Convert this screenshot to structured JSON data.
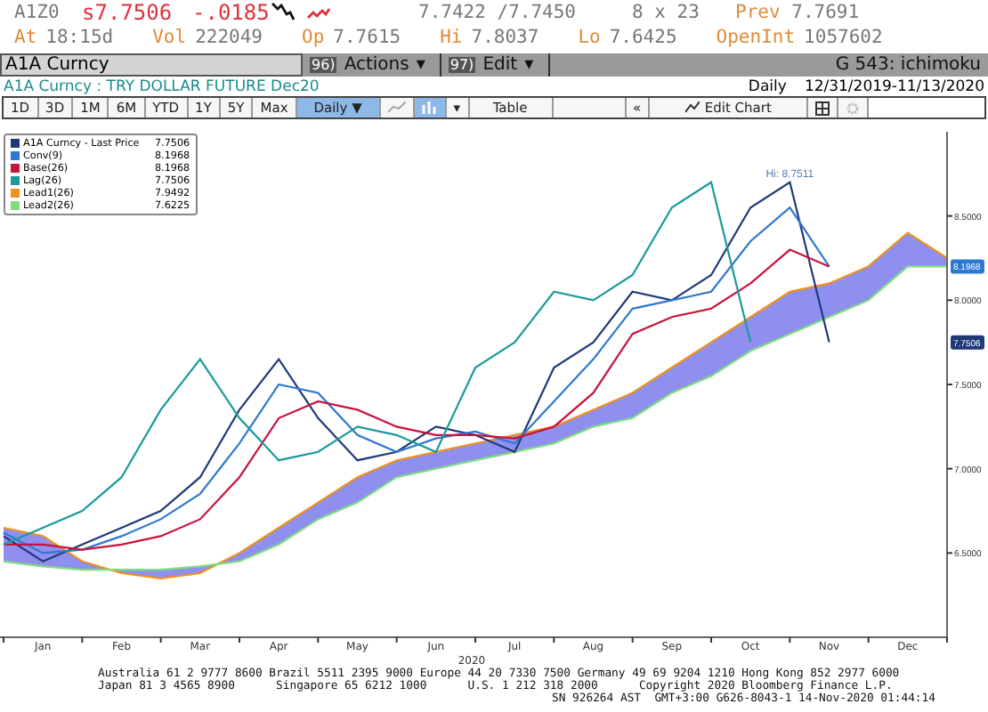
{
  "quote": {
    "ticker": "A1Z0",
    "last": "s7.7506",
    "change": "-.0185",
    "bid_ask": "7.7422 /7.7450",
    "size": "8 x 23",
    "prev_label": "Prev",
    "prev": "7.7691"
  },
  "stats": [
    {
      "label": "At",
      "value": "18:15d"
    },
    {
      "label": "Vol",
      "value": "222049"
    },
    {
      "label": "Op",
      "value": "7.7615"
    },
    {
      "label": "Hi",
      "value": "7.8037"
    },
    {
      "label": "Lo",
      "value": "7.6425"
    },
    {
      "label": "OpenInt",
      "value": "1057602"
    }
  ],
  "command_bar": {
    "security": "A1A Curncy",
    "menus": [
      {
        "number": "96)",
        "label": "Actions",
        "caret": "▾"
      },
      {
        "number": "97)",
        "label": "Edit",
        "caret": "▾"
      }
    ],
    "page": "G 543: ichimoku"
  },
  "title_row": {
    "title": "A1A Curncy : TRY DOLLAR FUTURE Dec20",
    "period": "Daily",
    "range": "12/31/2019-11/13/2020"
  },
  "toolbar": [
    {
      "kind": "text",
      "label": "1D",
      "selected": false
    },
    {
      "kind": "text",
      "label": "3D",
      "selected": false
    },
    {
      "kind": "text",
      "label": "1M",
      "selected": false
    },
    {
      "kind": "text",
      "label": "6M",
      "selected": false
    },
    {
      "kind": "text",
      "label": "YTD",
      "selected": false
    },
    {
      "kind": "text",
      "label": "1Y",
      "selected": false
    },
    {
      "kind": "text",
      "label": "5Y",
      "selected": false
    },
    {
      "kind": "text",
      "label": "Max",
      "selected": false
    },
    {
      "kind": "text",
      "label": "Daily ▼",
      "selected": true
    },
    {
      "kind": "line-icon",
      "selected": false
    },
    {
      "kind": "bar-icon",
      "selected": true
    },
    {
      "kind": "text",
      "label": "▾",
      "selected": false
    },
    {
      "kind": "text",
      "label": "Table",
      "selected": false
    },
    {
      "kind": "blank",
      "selected": false
    },
    {
      "kind": "text",
      "label": "«",
      "selected": false
    },
    {
      "kind": "edit",
      "label": "Edit Chart",
      "selected": false
    },
    {
      "kind": "grid-icon",
      "selected": false
    },
    {
      "kind": "gear-icon",
      "selected": false
    }
  ],
  "chart": {
    "legend_values": [
      "7.7506",
      "8.1968",
      "8.1968",
      "7.7506",
      "7.9492",
      "7.6225"
    ],
    "year_label": "2020",
    "chart_data": {
      "type": "line",
      "categories": [
        null,
        "Jan",
        null,
        "Feb",
        null,
        "Mar",
        null,
        "Apr",
        null,
        "May",
        null,
        "Jun",
        null,
        "Jul",
        null,
        "Aug",
        null,
        "Sep",
        null,
        "Oct",
        null,
        "Nov",
        null,
        "Dec",
        null
      ],
      "series": [
        {
          "name": "A1A Curncy - Last Price",
          "color": "#203a78",
          "values": [
            6.6,
            6.45,
            6.55,
            6.65,
            6.75,
            6.95,
            7.35,
            7.65,
            7.3,
            7.05,
            7.1,
            7.25,
            7.2,
            7.1,
            7.6,
            7.75,
            8.05,
            8.0,
            8.15,
            8.55,
            8.7,
            7.75,
            null,
            null,
            null
          ]
        },
        {
          "name": "Conv(9)",
          "color": "#2f78d0",
          "values": [
            6.62,
            6.5,
            6.52,
            6.6,
            6.7,
            6.85,
            7.15,
            7.5,
            7.45,
            7.2,
            7.1,
            7.18,
            7.22,
            7.15,
            7.4,
            7.65,
            7.95,
            8.0,
            8.05,
            8.35,
            8.55,
            8.2,
            null,
            null,
            null
          ]
        },
        {
          "name": "Base(26)",
          "color": "#c8143c",
          "values": [
            6.55,
            6.55,
            6.52,
            6.55,
            6.6,
            6.7,
            6.95,
            7.3,
            7.4,
            7.35,
            7.25,
            7.2,
            7.2,
            7.18,
            7.25,
            7.45,
            7.8,
            7.9,
            7.95,
            8.1,
            8.3,
            8.2,
            null,
            null,
            null
          ]
        },
        {
          "name": "Lag(26)",
          "color": "#1a9a9a",
          "values": [
            6.55,
            6.65,
            6.75,
            6.95,
            7.35,
            7.65,
            7.3,
            7.05,
            7.1,
            7.25,
            7.2,
            7.1,
            7.6,
            7.75,
            8.05,
            8.0,
            8.15,
            8.55,
            8.7,
            7.75,
            null,
            null,
            null,
            null,
            null
          ]
        },
        {
          "name": "Lead1(26)",
          "color": "#f0901e",
          "values": [
            6.65,
            6.6,
            6.45,
            6.38,
            6.35,
            6.38,
            6.5,
            6.65,
            6.8,
            6.95,
            7.05,
            7.1,
            7.15,
            7.2,
            7.25,
            7.35,
            7.45,
            7.6,
            7.75,
            7.9,
            8.05,
            8.1,
            8.2,
            8.4,
            8.25
          ]
        },
        {
          "name": "Lead2(26)",
          "color": "#7fdc7f",
          "values": [
            6.45,
            6.42,
            6.4,
            6.4,
            6.4,
            6.42,
            6.45,
            6.55,
            6.7,
            6.8,
            6.95,
            7.0,
            7.05,
            7.1,
            7.15,
            7.25,
            7.3,
            7.45,
            7.55,
            7.7,
            7.8,
            7.9,
            8.0,
            8.2,
            8.2
          ]
        }
      ],
      "ylim": [
        6.0,
        9.0
      ],
      "yticks": [
        {
          "value": 6.5,
          "label": "6.5000"
        },
        {
          "value": 7.0,
          "label": "7.0000"
        },
        {
          "value": 7.5,
          "label": "7.5000"
        },
        {
          "value": 8.0,
          "label": "8.0000"
        },
        {
          "value": 8.5,
          "label": "8.5000"
        }
      ],
      "annotations": [
        "Hi: 8.7511"
      ],
      "legend": true
    },
    "value_flags": [
      "8.1968",
      "7.7506"
    ]
  },
  "footer": [
    "Australia 61 2 9777 8600 Brazil 5511 2395 9000 Europe 44 20 7330 7500 Germany 49 69 9204 1210 Hong Kong 852 2977 6000",
    "Japan 81 3 4565 8900      Singapore 65 6212 1000      U.S. 1 212 318 2000      Copyright 2020 Bloomberg Finance L.P.",
    "SN 926264 AST  GMT+3:00 G626-8043-1 14-Nov-2020 01:44:14"
  ]
}
